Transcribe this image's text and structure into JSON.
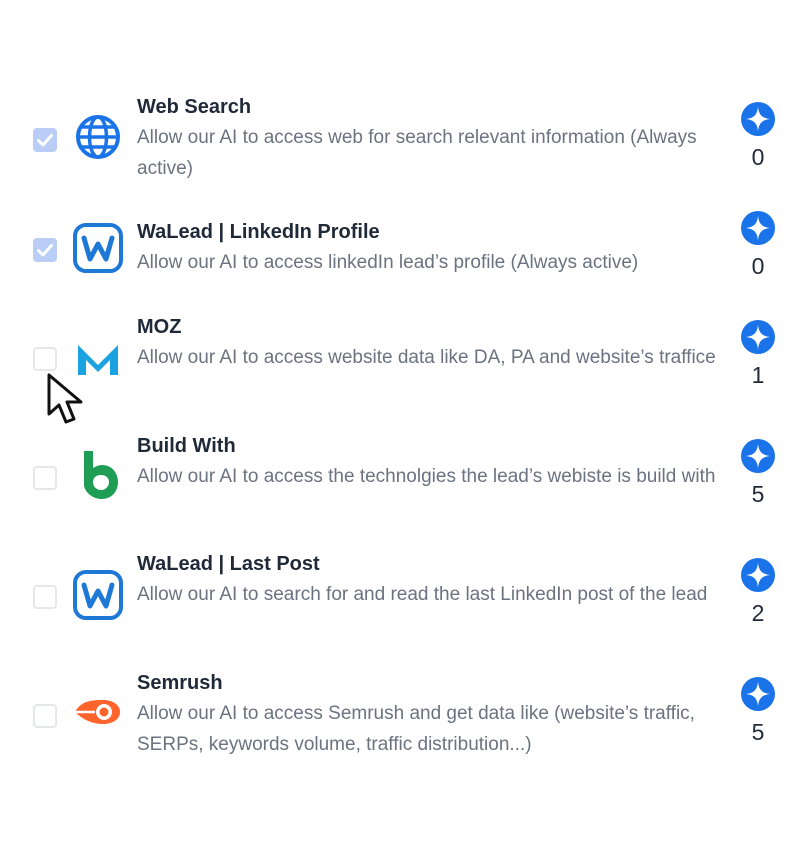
{
  "theme": {
    "accent": "#1a73e8",
    "checked_bg": "#b9cdf6",
    "title_color": "#1f2937",
    "desc_color": "#6b7280"
  },
  "integrations": [
    {
      "title": "Web Search",
      "description": "Allow our AI to access web for search relevant information (Always active)",
      "credits": "0",
      "checked": true,
      "icon": "globe-icon"
    },
    {
      "title": "WaLead | LinkedIn Profile",
      "description": "Allow our AI to access linkedIn lead’s profile (Always active)",
      "credits": "0",
      "checked": true,
      "icon": "walead-logo-icon"
    },
    {
      "title": "MOZ",
      "description": "Allow our AI to access website data like DA, PA and website’s traffice",
      "credits": "1",
      "checked": false,
      "icon": "moz-logo-icon"
    },
    {
      "title": "Build With",
      "description": "Allow our AI to access the technolgies the lead’s webiste is build with",
      "credits": "5",
      "checked": false,
      "icon": "builtwith-logo-icon"
    },
    {
      "title": "WaLead | Last Post",
      "description": "Allow our AI to search for and read the last LinkedIn post of the lead",
      "credits": "2",
      "checked": false,
      "icon": "walead-logo-icon"
    },
    {
      "title": "Semrush",
      "description": "Allow our AI to access Semrush and get data like (website’s traffic, SERPs, keywords volume, traffic distribution...)",
      "credits": "5",
      "checked": false,
      "icon": "semrush-logo-icon"
    }
  ]
}
